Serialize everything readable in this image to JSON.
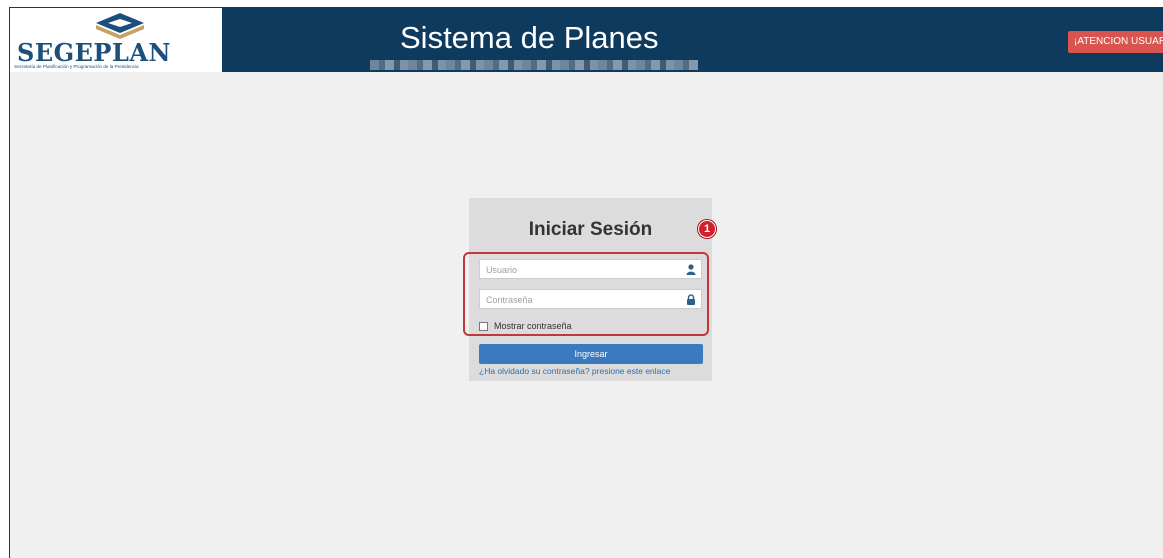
{
  "header": {
    "logo_text": "SEGEPLAN",
    "logo_subtitle": "Secretaría de Planificación y Programación de la Presidencia",
    "app_title": "Sistema de Planes",
    "attention_button": "¡ATENCION USUARIO!"
  },
  "login": {
    "title": "Iniciar Sesión",
    "step_badge": "1",
    "username_placeholder": "Usuario",
    "password_placeholder": "Contraseña",
    "show_password_label": "Mostrar contraseña",
    "submit_label": "Ingresar",
    "forgot_link": "¿Ha olvidado su contraseña? presione este enlace"
  },
  "colors": {
    "header_bg": "#0e3a5e",
    "attention_red": "#d9534f",
    "primary_blue": "#3b7abe",
    "highlight_red": "#c0383a"
  },
  "icons": {
    "username": "user-icon",
    "password": "lock-icon",
    "logo": "segeplan-logo-icon"
  }
}
